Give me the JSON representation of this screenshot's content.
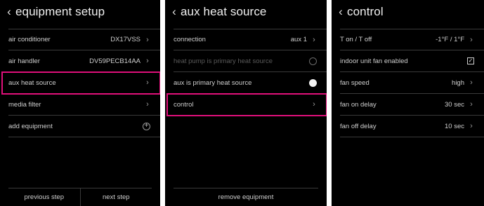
{
  "colors": {
    "highlight": "#e0107a",
    "background": "#000000",
    "text": "#cfcfcf"
  },
  "screen1": {
    "title": "equipment setup",
    "rows": [
      {
        "label": "air conditioner",
        "value": "DX17VSS"
      },
      {
        "label": "air handler",
        "value": "DV59PECB14AA"
      },
      {
        "label": "aux heat source",
        "value": ""
      },
      {
        "label": "media filter",
        "value": ""
      },
      {
        "label": "add equipment",
        "value": ""
      }
    ],
    "footer": {
      "previous": "previous step",
      "next": "next step"
    }
  },
  "screen2": {
    "title": "aux heat source",
    "rows": [
      {
        "label": "connection",
        "value": "aux 1"
      },
      {
        "label": "heat pump is primary heat source"
      },
      {
        "label": "aux is primary heat source"
      },
      {
        "label": "control"
      }
    ],
    "footer": {
      "remove": "remove equipment"
    }
  },
  "screen3": {
    "title": "control",
    "rows": [
      {
        "label": "T on / T off",
        "value": "-1°F / 1°F"
      },
      {
        "label": "indoor unit fan enabled",
        "value": ""
      },
      {
        "label": "fan speed",
        "value": "high"
      },
      {
        "label": "fan on delay",
        "value": "30 sec"
      },
      {
        "label": "fan off delay",
        "value": "10 sec"
      }
    ]
  },
  "icons": {
    "back": "chevron-left-icon",
    "next": "chevron-right-icon",
    "add": "plus-circle-icon",
    "checkbox": "checkbox-checked-icon",
    "radio": "radio-icon"
  }
}
